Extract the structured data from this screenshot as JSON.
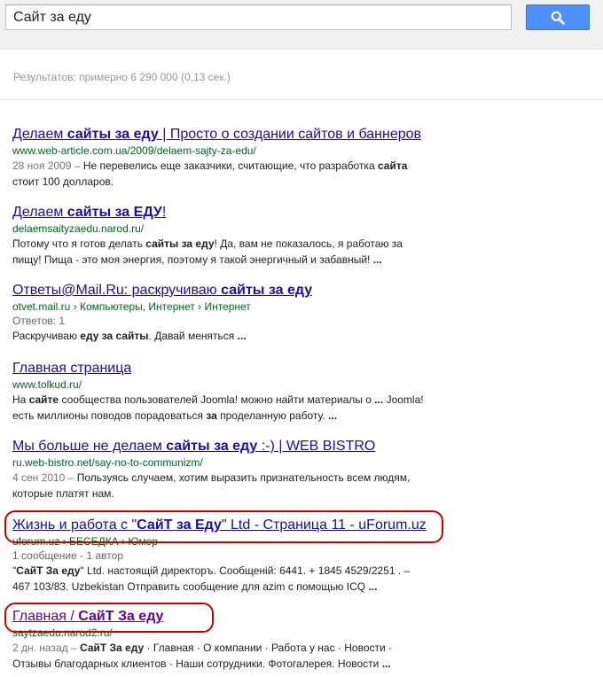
{
  "search": {
    "query": "Сайт за еду",
    "button_icon": "search-icon"
  },
  "stats": {
    "text": "Результатов: примерно 6 290 000 (0,13 сек.)"
  },
  "colors": {
    "link": "#1a0dab",
    "visited": "#660099",
    "url": "#006621",
    "button": "#4d90fe",
    "highlight": "#cc0000"
  },
  "results": [
    {
      "title": [
        {
          "t": "Делаем "
        },
        {
          "t": "сайты за еду",
          "b": true
        },
        {
          "t": " | Просто о создании сайтов и баннеров"
        }
      ],
      "url": "www.web-article.com.ua/2009/delaem-sajty-za-edu/",
      "meta": [],
      "snippet": [
        [
          {
            "t": "28 ноя 2009 – ",
            "d": true
          },
          {
            "t": "Не перевелись еще заказчики, считающие, что разработка "
          },
          {
            "t": "сайта",
            "b": true
          }
        ],
        [
          {
            "t": "стоит 100 долларов."
          }
        ]
      ]
    },
    {
      "title": [
        {
          "t": "Делаем "
        },
        {
          "t": "сайты за ЕДУ",
          "b": true
        },
        {
          "t": "!"
        }
      ],
      "url": "delaemsaityzaedu.narod.ru/",
      "meta": [],
      "snippet": [
        [
          {
            "t": "Потому что я готов делать "
          },
          {
            "t": "сайты за еду",
            "b": true
          },
          {
            "t": "! Да, вам не показалось, я работаю за"
          }
        ],
        [
          {
            "t": "пищу! Пища - это моя энергия, поэтому я такой энергичный и забавный! "
          },
          {
            "t": "...",
            "b": true
          }
        ]
      ]
    },
    {
      "title": [
        {
          "t": "Ответы@Mail.Ru: раскручиваю "
        },
        {
          "t": "сайты за еду",
          "b": true
        }
      ],
      "url": "otvet.mail.ru › Компьютеры, Интернет › Интернет",
      "meta": [
        "Ответов: 1"
      ],
      "snippet": [
        [
          {
            "t": "Раскручиваю "
          },
          {
            "t": "еду за сайты",
            "b": true
          },
          {
            "t": ". Давай меняться "
          },
          {
            "t": "...",
            "b": true
          }
        ]
      ]
    },
    {
      "title": [
        {
          "t": "Главная страница"
        }
      ],
      "url": "www.tolkud.ru/",
      "meta": [],
      "snippet": [
        [
          {
            "t": "На "
          },
          {
            "t": "сайте",
            "b": true
          },
          {
            "t": " сообщества пользователей Joomla! можно найти материалы о "
          },
          {
            "t": "...",
            "b": true
          },
          {
            "t": " Joomla!"
          }
        ],
        [
          {
            "t": "есть миллионы поводов порадоваться "
          },
          {
            "t": "за",
            "b": true
          },
          {
            "t": " проделанную работу. "
          },
          {
            "t": "...",
            "b": true
          }
        ]
      ]
    },
    {
      "title": [
        {
          "t": "Мы больше не делаем "
        },
        {
          "t": "сайты за еду",
          "b": true
        },
        {
          "t": " :-) | WEB BISTRO"
        }
      ],
      "url": "ru.web-bistro.net/say-no-to-communizm/",
      "meta": [],
      "snippet": [
        [
          {
            "t": "4 сен 2010 – ",
            "d": true
          },
          {
            "t": "Пользуясь случаем, хотим выразить признательность всем людям,"
          }
        ],
        [
          {
            "t": "которые платят нам."
          }
        ]
      ]
    },
    {
      "title": [
        {
          "t": "Жизнь и работа с \""
        },
        {
          "t": "СайТ за Еду",
          "b": true
        },
        {
          "t": "\" Ltd - Страница 11 - uForum.uz"
        }
      ],
      "url": "uforum.uz › БЕСЕДКА › Юмор",
      "meta": [
        "1 сообщение - 1 автор"
      ],
      "snippet": [
        [
          {
            "t": "\""
          },
          {
            "t": "СайТ За еду",
            "b": true
          },
          {
            "t": "\" Ltd. настоящій директоръ. Сообщеній: 6441. + 1845 4529/2251 . –"
          }
        ],
        [
          {
            "t": "467 103/83. Uzbekistan Отправить сообщение для azim с помощью ICQ "
          },
          {
            "t": "...",
            "b": true
          }
        ]
      ]
    },
    {
      "title": [
        {
          "t": "Главная / "
        },
        {
          "t": "СайТ За еду",
          "b": true
        }
      ],
      "visited": true,
      "url": "saytzaedu.narod2.ru/",
      "meta": [],
      "snippet": [
        [
          {
            "t": "2 дн. назад – ",
            "d": true
          },
          {
            "t": "СайТ За еду",
            "b": true
          },
          {
            "t": " · Главная · О компании · Работа у нас · Новости ·"
          }
        ],
        [
          {
            "t": "Отзывы благодарных клиентов · Наши сотрудники. Фотогалерея. Новости "
          },
          {
            "t": "...",
            "b": true
          }
        ]
      ]
    }
  ]
}
